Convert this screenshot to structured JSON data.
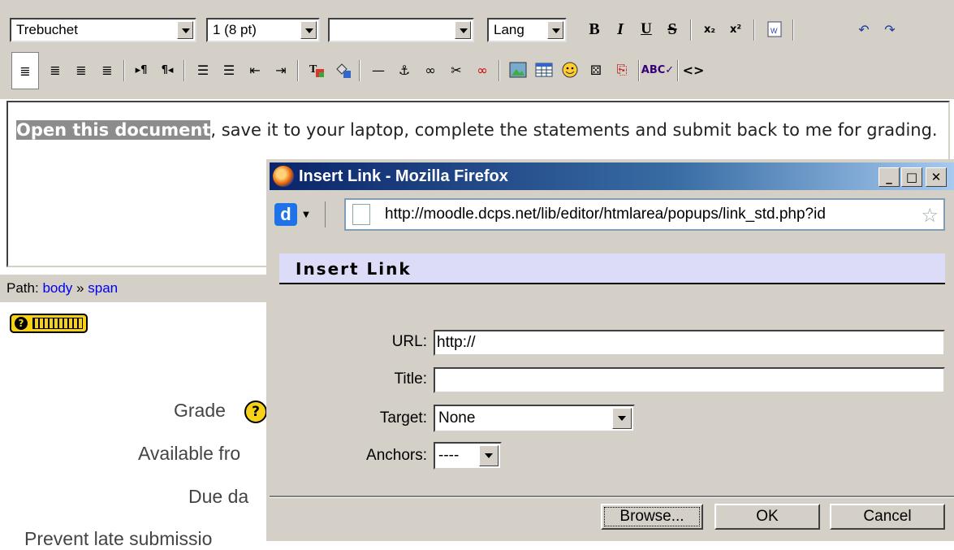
{
  "editor": {
    "toolbar": {
      "font_name": "Trebuchet",
      "font_size": "1 (8 pt)",
      "format": "",
      "lang": "Lang",
      "bold": "B",
      "italic": "I",
      "underline": "U",
      "strike": "S"
    },
    "content": {
      "selected_text": "Open this document",
      "rest_text": ", save it to your laptop, complete the statements and submit back to me for grading."
    },
    "path": {
      "label": "Path:",
      "items": [
        "body",
        "span"
      ],
      "separator": "»"
    }
  },
  "form": {
    "labels": [
      "Grade",
      "Available fro",
      "Due da",
      "Prevent late submissio"
    ]
  },
  "popup": {
    "window_title": "Insert Link - Mozilla Firefox",
    "url": "http://moodle.dcps.net/lib/editor/htmlarea/popups/link_std.php?id",
    "heading": "Insert Link",
    "fields": {
      "url_label": "URL:",
      "url_value": "http://",
      "title_label": "Title:",
      "title_value": "",
      "target_label": "Target:",
      "target_value": "None",
      "anchors_label": "Anchors:",
      "anchors_value": "----"
    },
    "buttons": {
      "browse": "Browse...",
      "ok": "OK",
      "cancel": "Cancel"
    }
  },
  "colors": {
    "titlebar_start": "#0a246a",
    "heading_bg": "#dcdcf8",
    "selection_bg": "#8c8c8c",
    "help_yellow": "#f7d117"
  }
}
